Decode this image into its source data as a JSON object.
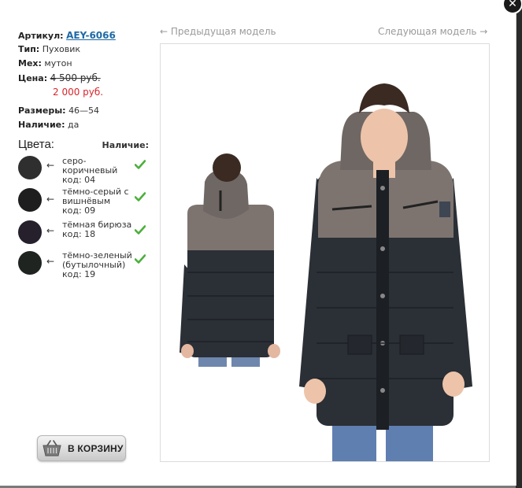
{
  "product": {
    "sku_label": "Артикул:",
    "sku_value": "AEY-6066",
    "type_label": "Тип:",
    "type_value": "Пуховик",
    "fur_label": "Мех:",
    "fur_value": "мутон",
    "price_label": "Цена:",
    "old_price": "4 500 руб.",
    "new_price": "2 000 руб.",
    "sizes_label": "Размеры:",
    "sizes_value": "46—54",
    "stock_label": "Наличие:",
    "stock_value": "да"
  },
  "colors_section": {
    "title": "Цвета:",
    "availability_header": "Наличие:",
    "items": [
      {
        "name": "серо-коричневый",
        "code": "код: 04",
        "hex": "#2f2f2f",
        "available": true,
        "arrow": "←"
      },
      {
        "name": "тёмно-серый с вишнёвым",
        "code": "код: 09",
        "hex": "#1e1e1e",
        "available": true,
        "arrow": "←"
      },
      {
        "name": "тёмная бирюза",
        "code": "код: 18",
        "hex": "#25202c",
        "available": true,
        "arrow": "←"
      },
      {
        "name": "тёмно-зеленый (бутылочный)",
        "code": "код: 19",
        "hex": "#1f2420",
        "available": true,
        "arrow": "←"
      }
    ]
  },
  "navigation": {
    "prev": "← Предыдущая модель",
    "next": "Следующая модель →"
  },
  "cart_button": {
    "label": "В КОРЗИНУ",
    "icon": "basket-icon"
  },
  "close_button": {
    "icon": "close-icon",
    "glyph": "✕"
  },
  "colors": {
    "link": "#1e6aa6",
    "sale_price": "#d7252b",
    "check": "#4caf3c",
    "jacket_dark": "#2b2f36",
    "jacket_taupe": "#7d7470"
  }
}
